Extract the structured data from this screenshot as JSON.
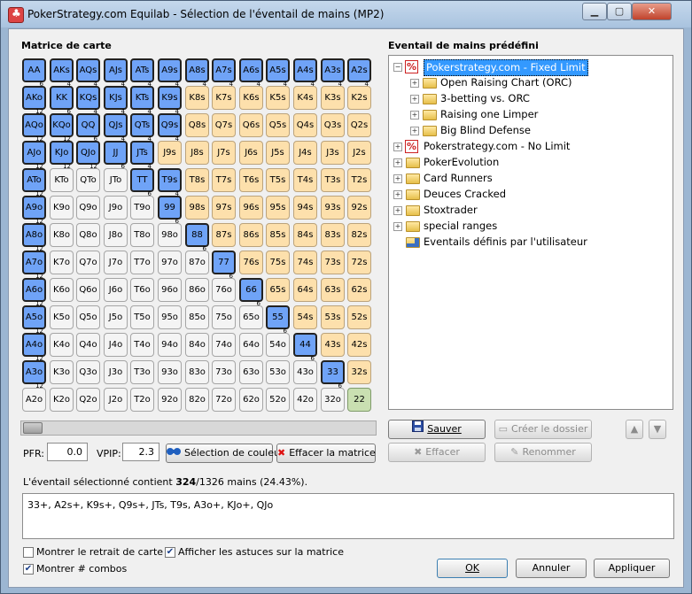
{
  "window": {
    "title": "PokerStrategy.com Equilab - Sélection de l'éventail de mains (MP2)",
    "minimize": "▁",
    "maximize": "▢",
    "close": "✕"
  },
  "matrix": {
    "heading": "Matrice de carte",
    "rows": [
      [
        "AA",
        "AKs",
        "AQs",
        "AJs",
        "ATs",
        "A9s",
        "A8s",
        "A7s",
        "A6s",
        "A5s",
        "A4s",
        "A3s",
        "A2s"
      ],
      [
        "AKo",
        "KK",
        "KQs",
        "KJs",
        "KTs",
        "K9s",
        "K8s",
        "K7s",
        "K6s",
        "K5s",
        "K4s",
        "K3s",
        "K2s"
      ],
      [
        "AQo",
        "KQo",
        "QQ",
        "QJs",
        "QTs",
        "Q9s",
        "Q8s",
        "Q7s",
        "Q6s",
        "Q5s",
        "Q4s",
        "Q3s",
        "Q2s"
      ],
      [
        "AJo",
        "KJo",
        "QJo",
        "JJ",
        "JTs",
        "J9s",
        "J8s",
        "J7s",
        "J6s",
        "J5s",
        "J4s",
        "J3s",
        "J2s"
      ],
      [
        "ATo",
        "KTo",
        "QTo",
        "JTo",
        "TT",
        "T9s",
        "T8s",
        "T7s",
        "T6s",
        "T5s",
        "T4s",
        "T3s",
        "T2s"
      ],
      [
        "A9o",
        "K9o",
        "Q9o",
        "J9o",
        "T9o",
        "99",
        "98s",
        "97s",
        "96s",
        "95s",
        "94s",
        "93s",
        "92s"
      ],
      [
        "A8o",
        "K8o",
        "Q8o",
        "J8o",
        "T8o",
        "98o",
        "88",
        "87s",
        "86s",
        "85s",
        "84s",
        "83s",
        "82s"
      ],
      [
        "A7o",
        "K7o",
        "Q7o",
        "J7o",
        "T7o",
        "97o",
        "87o",
        "77",
        "76s",
        "75s",
        "74s",
        "73s",
        "72s"
      ],
      [
        "A6o",
        "K6o",
        "Q6o",
        "J6o",
        "T6o",
        "96o",
        "86o",
        "76o",
        "66",
        "65s",
        "64s",
        "63s",
        "62s"
      ],
      [
        "A5o",
        "K5o",
        "Q5o",
        "J5o",
        "T5o",
        "95o",
        "85o",
        "75o",
        "65o",
        "55",
        "54s",
        "53s",
        "52s"
      ],
      [
        "A4o",
        "K4o",
        "Q4o",
        "J4o",
        "T4o",
        "94o",
        "84o",
        "74o",
        "64o",
        "54o",
        "44",
        "43s",
        "42s"
      ],
      [
        "A3o",
        "K3o",
        "Q3o",
        "J3o",
        "T3o",
        "93o",
        "83o",
        "73o",
        "63o",
        "53o",
        "43o",
        "33",
        "32s"
      ],
      [
        "A2o",
        "K2o",
        "Q2o",
        "J2o",
        "T2o",
        "92o",
        "82o",
        "72o",
        "62o",
        "52o",
        "42o",
        "32o",
        "22"
      ]
    ],
    "selected": [
      "AA",
      "AKs",
      "AQs",
      "AJs",
      "ATs",
      "A9s",
      "A8s",
      "A7s",
      "A6s",
      "A5s",
      "A4s",
      "A3s",
      "A2s",
      "AKo",
      "KK",
      "KQs",
      "KJs",
      "KTs",
      "K9s",
      "AQo",
      "KQo",
      "QQ",
      "QJs",
      "QTs",
      "Q9s",
      "AJo",
      "KJo",
      "QJo",
      "JJ",
      "JTs",
      "ATo",
      "TT",
      "T9s",
      "A9o",
      "99",
      "A8o",
      "88",
      "A7o",
      "77",
      "A6o",
      "66",
      "A5o",
      "55",
      "A4o",
      "44",
      "A3o",
      "33"
    ],
    "combos": {
      "pair": "6",
      "suited": "4",
      "offsuit": "12"
    }
  },
  "controls": {
    "pfr_label": "PFR:",
    "pfr_value": "0.0",
    "vpip_label": "VPIP:",
    "vpip_value": "2.3",
    "color_button": "Sélection de couleur",
    "clear_button": "Effacer la matrice"
  },
  "tree": {
    "heading": "Eventail de mains prédéfini",
    "nodes": [
      {
        "label": "Pokerstrategy.com - Fixed Limit",
        "level": 0,
        "icon": "ps-icon",
        "expander": "⊟"
      },
      {
        "label": "Open Raising Chart (ORC)",
        "level": 1,
        "icon": "folder-icon",
        "expander": "+"
      },
      {
        "label": "3-betting vs. ORC",
        "level": 1,
        "icon": "folder-icon",
        "expander": "+"
      },
      {
        "label": "Raising one Limper",
        "level": 1,
        "icon": "folder-icon",
        "expander": "+"
      },
      {
        "label": "Big Blind Defense",
        "level": 1,
        "icon": "folder-icon",
        "expander": "+"
      },
      {
        "label": "Pokerstrategy.com - No Limit",
        "level": 0,
        "icon": "ps-icon",
        "expander": "+"
      },
      {
        "label": "PokerEvolution",
        "level": 0,
        "icon": "folder-icon",
        "expander": "+"
      },
      {
        "label": "Card Runners",
        "level": 0,
        "icon": "folder-icon",
        "expander": "+"
      },
      {
        "label": "Deuces Cracked",
        "level": 0,
        "icon": "folder-icon",
        "expander": "+"
      },
      {
        "label": "Stoxtrader",
        "level": 0,
        "icon": "folder-icon",
        "expander": "+"
      },
      {
        "label": "special ranges",
        "level": 0,
        "icon": "folder-icon",
        "expander": "+"
      },
      {
        "label": "Eventails définis par l'utilisateur",
        "level": 0,
        "icon": "user-folder-icon",
        "expander": ""
      }
    ]
  },
  "tree_buttons": {
    "save": "Sauver",
    "create_folder": "Créer le dossier",
    "delete": "Effacer",
    "rename": "Renommer",
    "up": "▲",
    "down": "▼"
  },
  "summary": {
    "prefix": "L'éventail sélectionné contient ",
    "count": "324",
    "suffix": "/1326 mains (24.43%)."
  },
  "range_text": "33+, A2s+, K9s+, Q9s+, JTs, T9s, A3o+, KJo+, QJo",
  "options": {
    "show_card_removal": "Montrer le retrait de carte",
    "show_card_removal_checked": false,
    "show_tips": "Afficher les astuces sur la matrice",
    "show_tips_checked": true,
    "show_combos": "Montrer # combos",
    "show_combos_checked": true
  },
  "footer": {
    "ok": "OK",
    "cancel": "Annuler",
    "apply": "Appliquer"
  },
  "colors": {
    "selected": "#6fa3f7",
    "suited": "#fde0ac",
    "offsuit": "#f4f4f4",
    "pair_unselected": "#c9dfb1"
  }
}
